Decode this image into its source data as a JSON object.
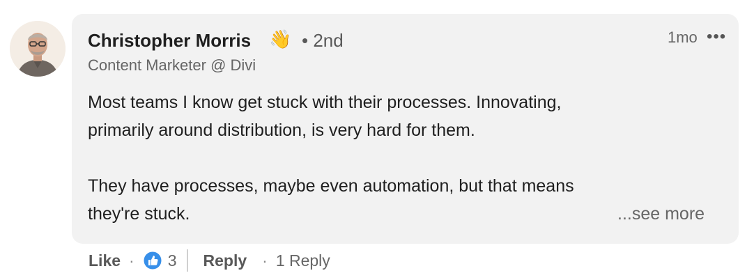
{
  "comment": {
    "author": {
      "name": "Christopher Morris",
      "emoji": "👋",
      "degree": "• 2nd",
      "headline": "Content Marketer @ Divi"
    },
    "timestamp": "1mo",
    "more_icon": "•••",
    "body": {
      "paragraph_1_line_1": "Most teams I know get stuck with their processes. Innovating,",
      "paragraph_1_line_2": "primarily around distribution, is very hard for them.",
      "paragraph_2_line_1": "They have processes, maybe even automation, but that means",
      "paragraph_2_line_2": "they're stuck."
    },
    "see_more_label": "...see more",
    "actions": {
      "like_label": "Like",
      "separator": "·",
      "like_count": "3",
      "reply_label": "Reply",
      "replies_label": "1 Reply"
    },
    "icons": {
      "avatar": "avatar",
      "wave": "waving-hand-icon",
      "reaction": "thumbs-up-reaction-icon",
      "more": "ellipsis-icon"
    },
    "colors": {
      "bubble": "#f2f2f2",
      "reaction_blue": "#378fe9"
    }
  }
}
